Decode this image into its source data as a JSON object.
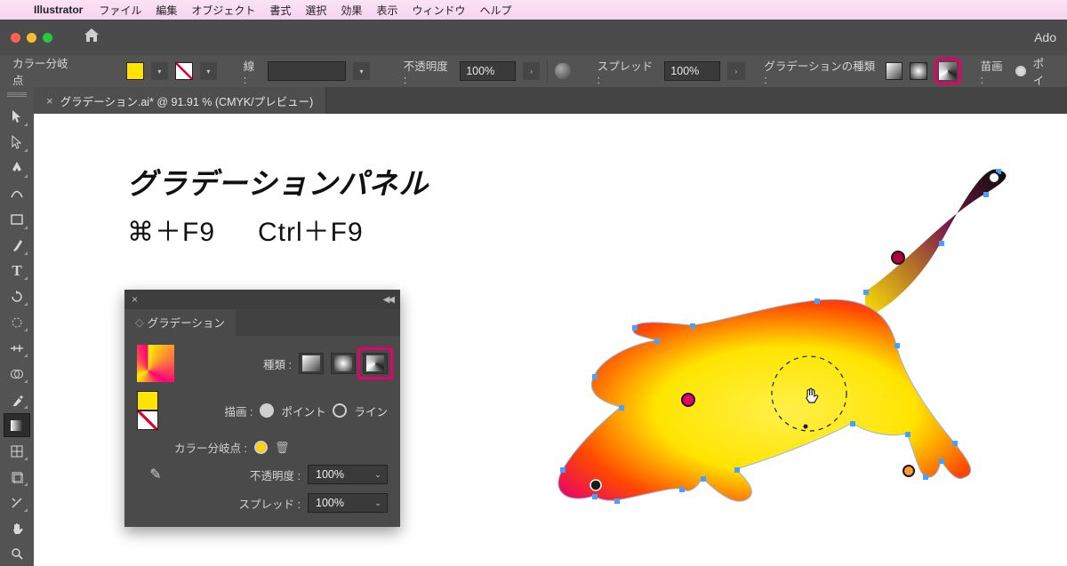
{
  "menubar": {
    "app": "Illustrator",
    "items": [
      "ファイル",
      "編集",
      "オブジェクト",
      "書式",
      "選択",
      "効果",
      "表示",
      "ウィンドウ",
      "ヘルプ"
    ]
  },
  "appbar": {
    "brand": "Ado"
  },
  "optbar": {
    "label": "カラー分岐点",
    "stroke_label": "線 :",
    "opacity_label": "不透明度 :",
    "opacity_value": "100%",
    "spread_label": "スプレッド :",
    "spread_value": "100%",
    "gradtype_label": "グラデーションの種類 :",
    "stroke_paint_label": "苗画 :",
    "point_label": "ポイ"
  },
  "doc_tab": {
    "name": "グラデーション.ai* @ 91.91 % (CMYK/プレビュー)"
  },
  "canvas": {
    "title": "グラデーションパネル",
    "keys_mac": "⌘＋F9",
    "keys_win": "Ctrl＋F9"
  },
  "panel": {
    "title": "グラデーション",
    "type_label": "種類 :",
    "stroke_paint_label": "描画 :",
    "point_opt": "ポイント",
    "line_opt": "ライン",
    "colorstop_label": "カラー分岐点 :",
    "opacity_label": "不透明度 :",
    "opacity_value": "100%",
    "spread_label": "スプレッド :",
    "spread_value": "100%"
  },
  "tools": [
    "select",
    "direct",
    "pen",
    "curve",
    "rect",
    "brush",
    "type",
    "rotate",
    "scale",
    "width",
    "shapebuilder",
    "blend",
    "eyedrop",
    "gradient",
    "mesh",
    "artboard",
    "slice",
    "hand",
    "zoom"
  ]
}
